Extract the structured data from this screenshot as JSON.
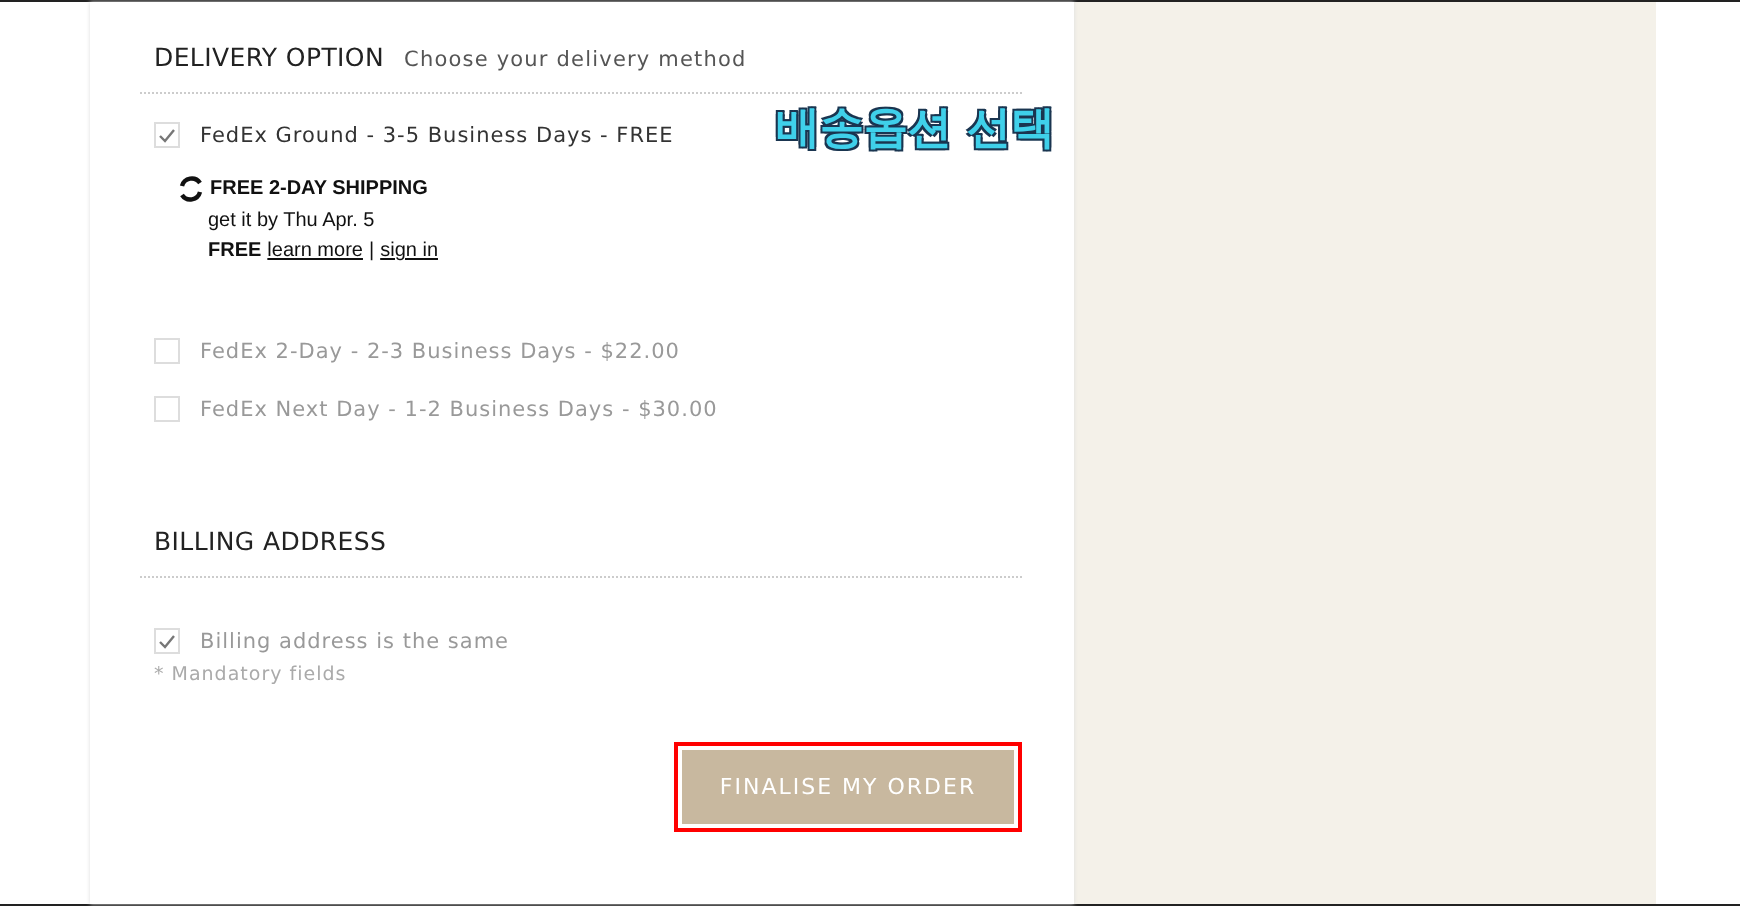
{
  "delivery": {
    "title": "DELIVERY OPTION",
    "subtitle": "Choose your delivery method",
    "options": [
      {
        "label": "FedEx Ground - 3-5 Business Days - FREE",
        "checked": true
      },
      {
        "label": "FedEx 2-Day - 2-3 Business Days - $22.00",
        "checked": false
      },
      {
        "label": "FedEx Next Day - 1-2 Business Days - $30.00",
        "checked": false
      }
    ],
    "promo": {
      "title": "FREE 2-DAY SHIPPING",
      "line": "get it by Thu Apr. 5",
      "free": "FREE",
      "learn_more": "learn more",
      "separator": "|",
      "sign_in": "sign in"
    }
  },
  "annotation": {
    "text": "배송옵션 선택",
    "highlight_button": true
  },
  "billing": {
    "title": "BILLING ADDRESS",
    "same": {
      "label": "Billing address is the same",
      "checked": true
    },
    "note": "* Mandatory fields"
  },
  "button": "FINALISE MY ORDER"
}
